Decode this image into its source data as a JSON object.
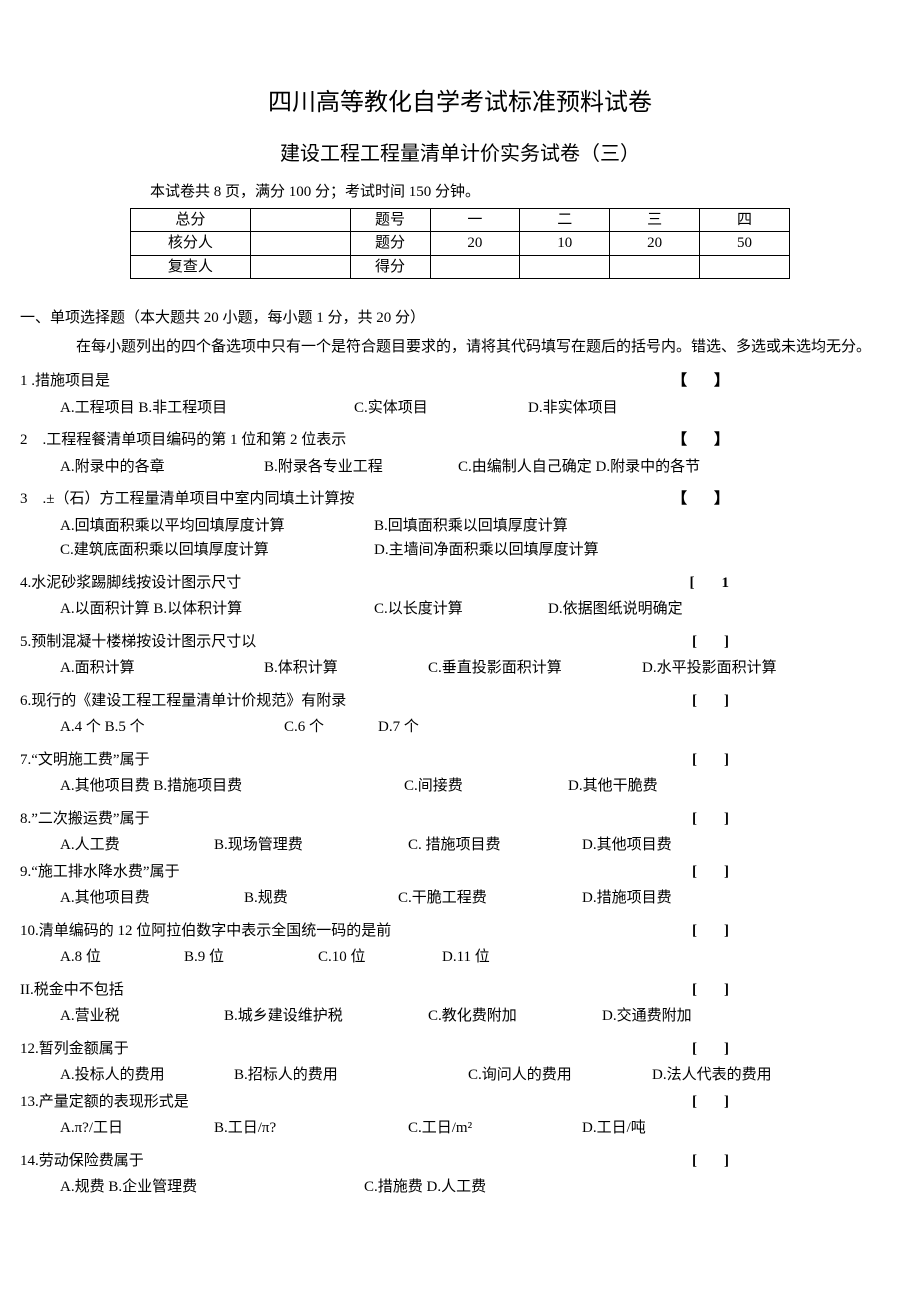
{
  "header": {
    "title": "四川高等教化自学考试标准预料试卷",
    "subtitle": "建设工程工程量清单计价实务试卷（三）",
    "info": "本试卷共 8 页，满分 100 分；考试时间 150 分钟。"
  },
  "score_table": {
    "r1c1": "总分",
    "r1c3": "题号",
    "r1c4": "一",
    "r1c5": "二",
    "r1c6": "三",
    "r1c7": "四",
    "r2c1": "核分人",
    "r2c3": "题分",
    "r2c4": "20",
    "r2c5": "10",
    "r2c6": "20",
    "r2c7": "50",
    "r3c1": "复查人",
    "r3c3": "得分"
  },
  "section1": {
    "head": "一、单项选择题（本大题共 20 小题，每小题 1 分，共 20 分）",
    "note": "在每小题列出的四个备选项中只有一个是符合题目要求的，请将其代码填写在题后的括号内。错选、多选或未选均无分。"
  },
  "bracket_bold": "【　】",
  "bracket_thin": "[　]",
  "bracket_1": "[　1",
  "q1": {
    "text": "1 .措施项目是",
    "a": "A.工程项目 B.非工程项目",
    "c": "C.实体项目",
    "d": "D.非实体项目"
  },
  "q2": {
    "text": "2　.工程程餐清单项目编码的第 1 位和第 2 位表示",
    "a": "A.附录中的各章",
    "b": "B.附录各专业工程",
    "c": "C.由编制人自己确定 D.附录中的各节"
  },
  "q3": {
    "text": "3　.±（石）方工程量清单项目中室内同填土计算按",
    "a": "A.回填面积乘以平均回填厚度计算",
    "b": "B.回填面积乘以回填厚度计算",
    "c": "C.建筑底面积乘以回填厚度计算",
    "d": "D.主墙间净面积乘以回填厚度计算"
  },
  "q4": {
    "text": "4.水泥砂浆踢脚线按设计图示尺寸",
    "a": "A.以面积计算 B.以体积计算",
    "c": "C.以长度计算",
    "d": "D.依据图纸说明确定"
  },
  "q5": {
    "text": "5.预制混凝十楼梯按设计图示尺寸以",
    "a": "A.面积计算",
    "b": "B.体积计算",
    "c": "C.垂直投影面积计算",
    "d": "D.水平投影面积计算"
  },
  "q6": {
    "text": "6.现行的《建设工程工程量清单计价规范》有附录",
    "a": "A.4 个 B.5 个",
    "c": "C.6 个",
    "d": "D.7 个"
  },
  "q7": {
    "text": "7.“文明施工费”属于",
    "a": "A.其他项目费 B.措施项目费",
    "c": "C.间接费",
    "d": "D.其他干脆费"
  },
  "q8": {
    "text": "8.”二次搬运费”属于",
    "a": "A.人工费",
    "b": "B.现场管理费",
    "c": "C. 措施项目费",
    "d": "D.其他项目费"
  },
  "q9": {
    "text": "9.“施工排水降水费”属于",
    "a": "A.其他项目费",
    "b": "B.规费",
    "c": "C.干脆工程费",
    "d": "D.措施项目费"
  },
  "q10": {
    "text": "10.清单编码的 12 位阿拉伯数字中表示全国统一码的是前",
    "a": "A.8 位",
    "b": "B.9 位",
    "c": "C.10 位",
    "d": "D.11 位"
  },
  "q11": {
    "text": "II.税金中不包括",
    "a": "A.营业税",
    "b": "B.城乡建设维护税",
    "c": "C.教化费附加",
    "d": "D.交通费附加"
  },
  "q12": {
    "text": "12.暂列金额属于",
    "a": "A.投标人的费用",
    "b": "B.招标人的费用",
    "c": "C.询问人的费用",
    "d": "D.法人代表的费用"
  },
  "q13": {
    "text": "13.产量定额的表现形式是",
    "a": "A.π?/工日",
    "b": "B.工日/π?",
    "c": "C.工日/m²",
    "d": "D.工日/吨"
  },
  "q14": {
    "text": "14.劳动保险费属于",
    "a": "A.规费 B.企业管理费",
    "c": "C.措施费 D.人工费"
  }
}
